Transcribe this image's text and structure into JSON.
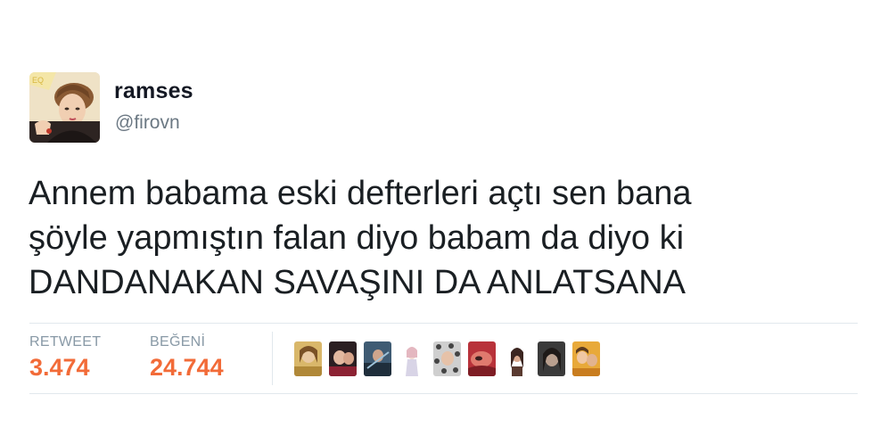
{
  "user": {
    "name": "ramses",
    "handle": "@firovn"
  },
  "tweet": {
    "text": "Annem babama eski defterleri açtı sen bana\nşöyle yapmıştın falan diyo babam da diyo ki\nDANDANAKAN SAVAŞINI DA ANLATSANA"
  },
  "stats": {
    "retweet_label": "RETWEET",
    "retweet_count": "3.474",
    "like_label": "BEĞENİ",
    "like_count": "24.744"
  },
  "colors": {
    "stat_value": "#f26b38",
    "stat_label": "#8899a6",
    "handle": "#6b7883",
    "divider": "#e1e8ed"
  },
  "likers_count_shown": 9
}
